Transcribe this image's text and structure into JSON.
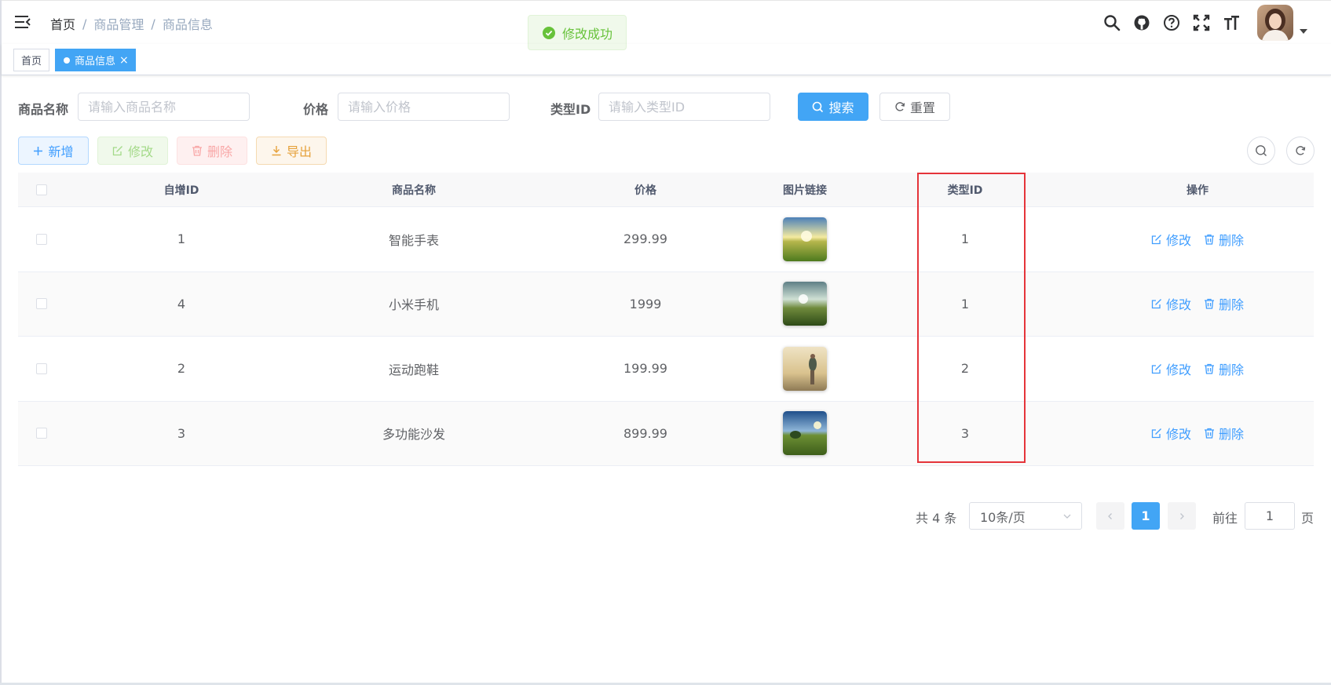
{
  "navbar": {
    "breadcrumb": [
      "首页",
      "商品管理",
      "商品信息"
    ],
    "icons": [
      "search-icon",
      "github-icon",
      "question-icon",
      "fullscreen-icon",
      "font-size-icon"
    ]
  },
  "toast": {
    "message": "修改成功",
    "color": "#67c23a"
  },
  "tags": {
    "home": "首页",
    "active": "商品信息"
  },
  "search": {
    "name_label": "商品名称",
    "name_placeholder": "请输入商品名称",
    "price_label": "价格",
    "price_placeholder": "请输入价格",
    "type_label": "类型ID",
    "type_placeholder": "请输入类型ID",
    "search_button": "搜索",
    "reset_button": "重置"
  },
  "toolbar": {
    "add": "新增",
    "edit": "修改",
    "delete": "删除",
    "export": "导出"
  },
  "table": {
    "headers": [
      "自增ID",
      "商品名称",
      "价格",
      "图片链接",
      "类型ID",
      "操作"
    ],
    "rows": [
      {
        "id": "1",
        "name": "智能手表",
        "price": "299.99",
        "type_id": "1",
        "edit": "修改",
        "delete": "删除"
      },
      {
        "id": "4",
        "name": "小米手机",
        "price": "1999",
        "type_id": "1",
        "edit": "修改",
        "delete": "删除"
      },
      {
        "id": "2",
        "name": "运动跑鞋",
        "price": "199.99",
        "type_id": "2",
        "edit": "修改",
        "delete": "删除"
      },
      {
        "id": "3",
        "name": "多功能沙发",
        "price": "899.99",
        "type_id": "3",
        "edit": "修改",
        "delete": "删除"
      }
    ]
  },
  "pagination": {
    "total": "共 4 条",
    "page_size": "10条/页",
    "current_page": "1",
    "goto_label": "前往",
    "goto_value": "1",
    "page_suffix": "页"
  },
  "colors": {
    "primary": "#42a5f5",
    "highlight_box": "#e5343a"
  }
}
